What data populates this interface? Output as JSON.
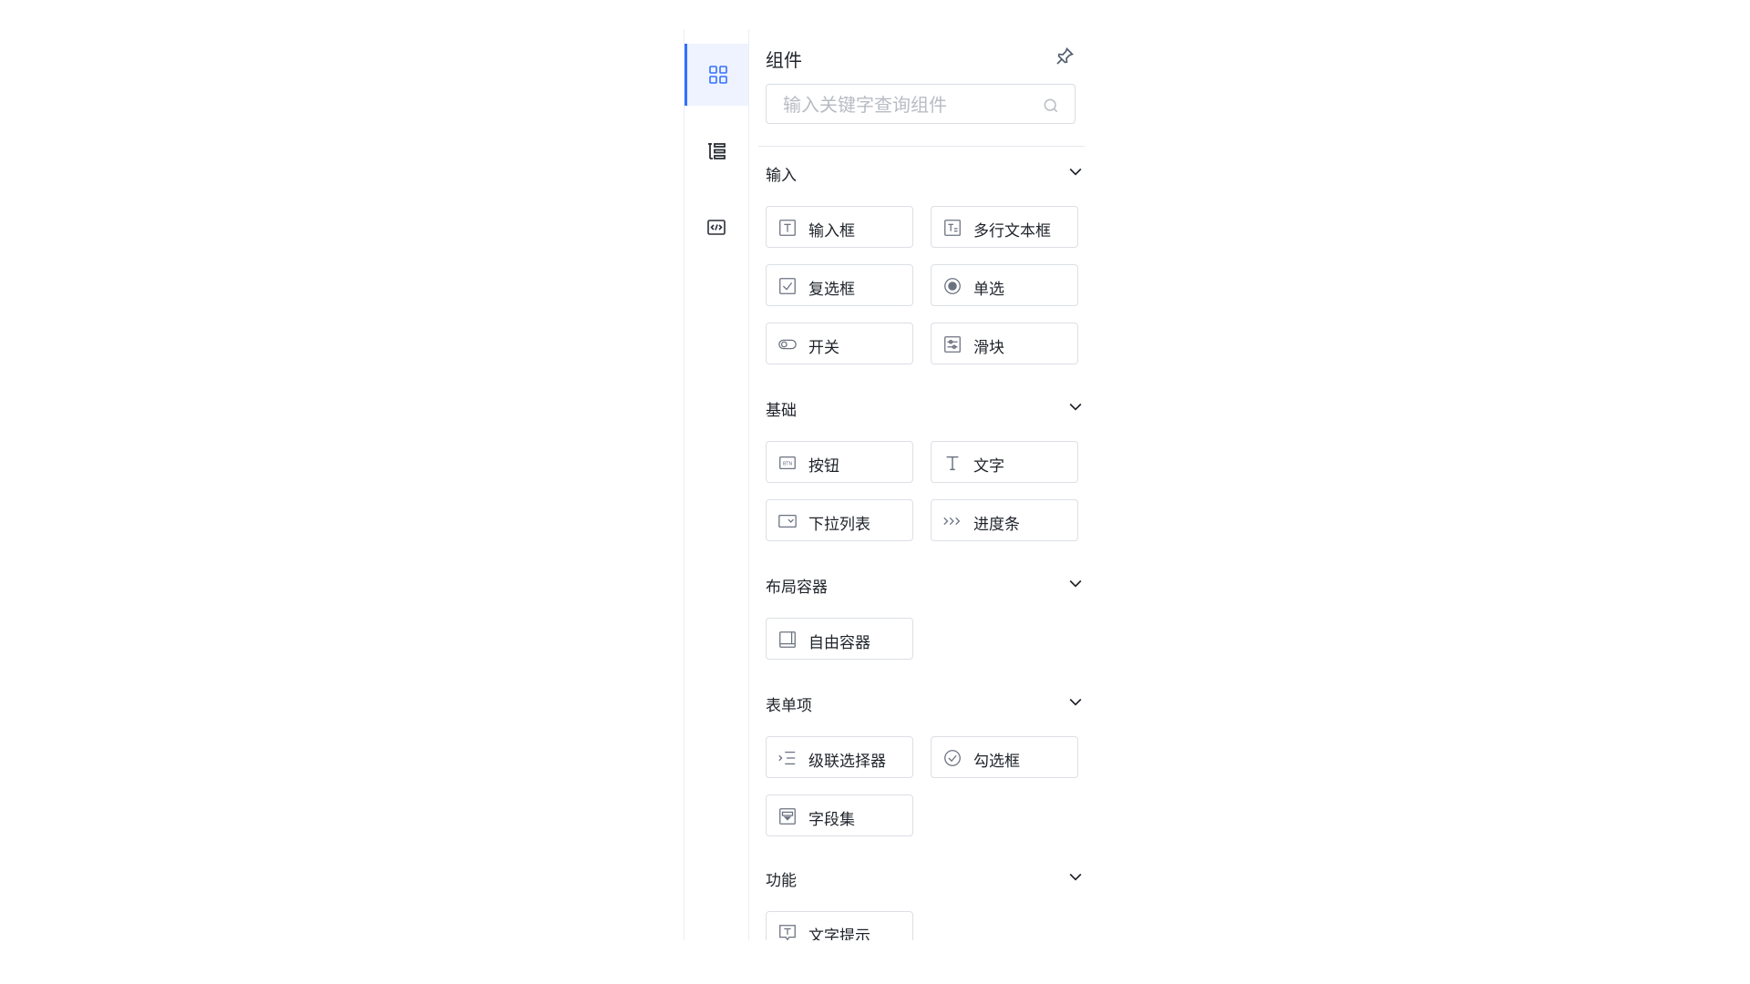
{
  "panel": {
    "title": "组件",
    "search_placeholder": "输入关键字查询组件"
  },
  "rail": {
    "items": [
      {
        "name": "components",
        "icon": "grid-icon",
        "active": true
      },
      {
        "name": "outline",
        "icon": "tree-list-icon",
        "active": false
      },
      {
        "name": "code",
        "icon": "code-icon",
        "active": false
      }
    ]
  },
  "colors": {
    "accent": "#3370ff",
    "active_bg": "#eef3ff",
    "border": "#dcdfe4"
  },
  "sections": [
    {
      "title": "输入",
      "items": [
        {
          "label": "输入框",
          "icon": "text-input-icon"
        },
        {
          "label": "多行文本框",
          "icon": "textarea-icon"
        },
        {
          "label": "复选框",
          "icon": "checkbox-icon"
        },
        {
          "label": "单选",
          "icon": "radio-icon"
        },
        {
          "label": "开关",
          "icon": "switch-icon"
        },
        {
          "label": "滑块",
          "icon": "slider-icon"
        }
      ]
    },
    {
      "title": "基础",
      "items": [
        {
          "label": "按钮",
          "icon": "button-icon"
        },
        {
          "label": "文字",
          "icon": "text-icon"
        },
        {
          "label": "下拉列表",
          "icon": "dropdown-icon"
        },
        {
          "label": "进度条",
          "icon": "progress-icon"
        }
      ]
    },
    {
      "title": "布局容器",
      "items": [
        {
          "label": "自由容器",
          "icon": "container-icon"
        }
      ]
    },
    {
      "title": "表单项",
      "items": [
        {
          "label": "级联选择器",
          "icon": "cascader-icon"
        },
        {
          "label": "勾选框",
          "icon": "check-circle-icon"
        },
        {
          "label": "字段集",
          "icon": "fieldset-icon"
        }
      ]
    },
    {
      "title": "功能",
      "items": [
        {
          "label": "文字提示",
          "icon": "tooltip-icon"
        }
      ]
    }
  ]
}
